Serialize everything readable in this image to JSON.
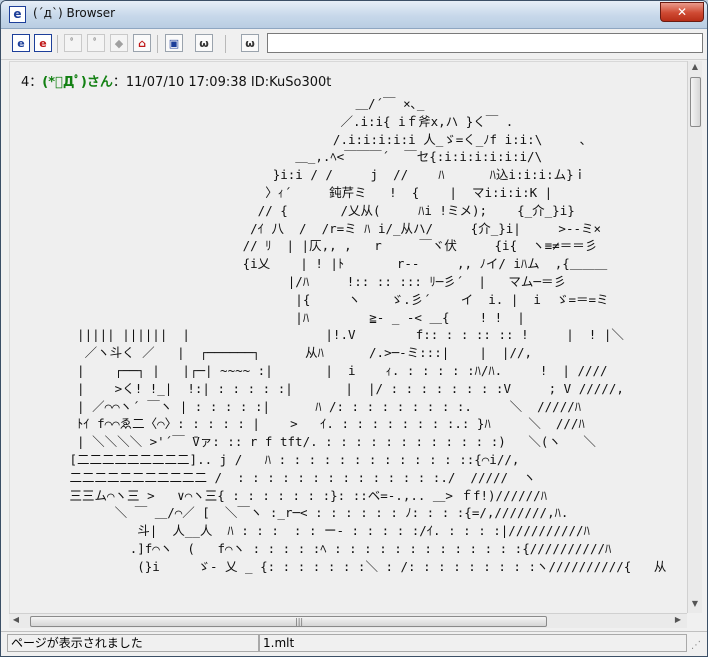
{
  "window": {
    "app_icon": "e",
    "title": "(´д`) Browser",
    "close_glyph": "✕"
  },
  "toolbar": {
    "buttons": [
      {
        "name": "e-icon",
        "glyph": "e"
      },
      {
        "name": "e-red-icon",
        "glyph": "e"
      },
      {
        "name": "back-cat-icon",
        "glyph": "ﾟ"
      },
      {
        "name": "forward-cat-icon",
        "glyph": "ﾟ"
      },
      {
        "name": "stop-cat-icon",
        "glyph": "◆"
      },
      {
        "name": "home-icon",
        "glyph": "⌂"
      },
      {
        "name": "view-icon",
        "glyph": "▣"
      },
      {
        "name": "cat-face-icon",
        "glyph": "ω"
      },
      {
        "name": "cat-settings-icon",
        "glyph": "ω"
      }
    ],
    "address_value": ""
  },
  "post": {
    "number": "4",
    "separator": "：",
    "name": "(*ﾟДﾟ)さん",
    "meta": "：11/07/10 17:09:38 ID:KuSo300t"
  },
  "ascii_art": "                                       ＿/´￣ ×､_\n                                     ／.i:i{ iｆ斧x,ハ }く￣ .\n                                    /.i:i:i:i:i 人_ゞ=く_ﾉf i:i:\\     ､\n                               ＿_,.ﾍ<￣￣￣´  ￣セ{:i:i:i:i:i:i/\\\n                            }i:i / /     j  //    ﾊ      ﾊ込i:i:i:ム}ｉ\n                           〉ｨ´     鈍芹ミ   !  {    |  マi:i:i:K |\n                          // {       /乂从(     ﾊi !ミメ);    {_介_}i}\n                         /ｲ 八  /  /r=ミ ﾊ i/_从ハ/     {介_}i|     >‐‐ミ×\n                        // ﾘ  | |仄,, ,   r     ￣ヾ伏     {i{  ヽ≡≠＝＝彡\n                        {i乂    | ! |ﾄ       r‐-     ,, ﾉイ/ iﾊム  ,{＿＿＿\n                              |/ﾊ     !:: :: ::: ﾘ─彡´  |   マム─＝彡\n                               |{     ヽ    ゞ.彡´    イ  i. |  i  ゞ=＝=ミ\n                               |ﾊ        ≧- _ -< ＿{    ! !  |\n  ||||| ||||||  |                  |!.V        f:: : : :: :: !     |  ! |＼\n   ／ヽ斗く ／   |  ┌──────┐      从ﾊ      /.>─-ミ:::|    |  |//,\n  |    ┌──┐ |   |┌─| ~~~~ :|       |  i    ｨ. : : : : :ﾊ/ﾊ.     !  | ////\n  |    >く! !_|  !:| : : : : :|       |  |/ : : : : : : : :V     ; V /////,\n  | ／⌒⌒ヽ´ ￣ヽ | : : : : :|      ﾊ /: : : : : : : : :.     ＼  /////ﾊ\n  ﾄｲ f⌒⌒ゑ二〈⌒〉: : : : : |    >   ｲ. : : : : : : : :.: }ﾊ     ＼  ///ﾊ\n  | ＼＼＼＼ >'´￣ ̄Vァ: :: r f tft/. : : : : : : : : : : : :)   ＼(ヽ   ＼\n [二二二二二二二二二].. j /   ﾊ : : : : : : : : : : : : ::{⌒i//,\n 二二二二二二二二二二二 /  : : : : : : : : : : : : : :./  /////  ヽ\n 三三ム⌒ヽ三 >   ∨⌒ヽ三{ : : : : : : :}: ::ベ=-.,.. ＿> ｆf!)//////ﾊ\n       ＼ ￣ ＿/⌒／ [  ＼￣ヽ :_r─< : : : : : : ﾉ: : : :{=/,///////,ﾊ.\n          斗|  人__人  ﾊ : : :  : : ー- : : : : :/ｲ. : : : :|//////////ﾊ\n         .]f⌒ヽ  (   f⌒ヽ : : : : :ﾍ : : : : : : : : : : : : :{//////////ﾊ\n          (}i     ゞ- 乂 _ {: : : : : : :＼ : /: : : : : : : : :ヽ//////////{   从",
  "status": {
    "message": "ページが表示されました",
    "file": "1.mlt"
  }
}
